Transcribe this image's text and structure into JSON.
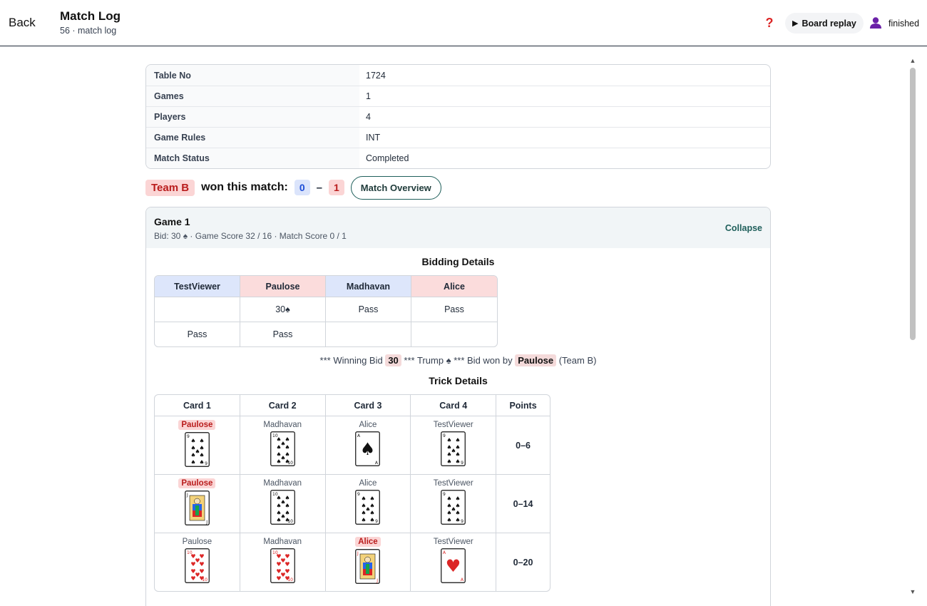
{
  "header": {
    "back_label": "Back",
    "title": "Match Log",
    "subtitle": "56 · match log",
    "help_icon": "question-mark-icon",
    "replay_label": "Board replay",
    "user_status": "finished"
  },
  "info": [
    {
      "key": "Table No",
      "value": "1724"
    },
    {
      "key": "Games",
      "value": "1"
    },
    {
      "key": "Players",
      "value": "4"
    },
    {
      "key": "Game Rules",
      "value": "INT"
    },
    {
      "key": "Match Status",
      "value": "Completed"
    }
  ],
  "result": {
    "team": "Team B",
    "text": "won this match:",
    "score_a": "0",
    "dash": "–",
    "score_b": "1",
    "overview_label": "Match Overview"
  },
  "game": {
    "title": "Game 1",
    "meta": "Bid: 30 ♠   ·   Game Score 32 / 16   ·   Match Score 0 / 1",
    "collapse_label": "Collapse",
    "bidding_title": "Bidding Details",
    "bidding_players": [
      "TestViewer",
      "Paulose",
      "Madhavan",
      "Alice"
    ],
    "bidding_rows": [
      [
        "",
        "30♠",
        "Pass",
        "Pass"
      ],
      [
        "Pass",
        "Pass",
        "",
        ""
      ]
    ],
    "win_prefix": "*** Winning Bid",
    "win_bid": "30",
    "win_trump_text": "***  Trump",
    "win_trump": "♠",
    "win_by_text": "***  Bid won by",
    "win_player": "Paulose",
    "win_team": "(Team B)",
    "trick_title": "Trick Details",
    "trick_headers": [
      "Card 1",
      "Card 2",
      "Card 3",
      "Card 4",
      "Points"
    ],
    "tricks": [
      {
        "players": [
          "Paulose",
          "Madhavan",
          "Alice",
          "TestViewer"
        ],
        "lead": 0,
        "cards": [
          {
            "rank": "9",
            "suit": "♠"
          },
          {
            "rank": "10",
            "suit": "♠"
          },
          {
            "rank": "A",
            "suit": "♠"
          },
          {
            "rank": "9",
            "suit": "♠"
          }
        ],
        "points": "0–6"
      },
      {
        "players": [
          "Paulose",
          "Madhavan",
          "Alice",
          "TestViewer"
        ],
        "lead": 0,
        "cards": [
          {
            "rank": "J",
            "suit": "♠"
          },
          {
            "rank": "10",
            "suit": "♠"
          },
          {
            "rank": "9",
            "suit": "♠"
          },
          {
            "rank": "9",
            "suit": "♠"
          }
        ],
        "points": "0–14"
      },
      {
        "players": [
          "Paulose",
          "Madhavan",
          "Alice",
          "TestViewer"
        ],
        "lead": 2,
        "cards": [
          {
            "rank": "10",
            "suit": "♥"
          },
          {
            "rank": "10",
            "suit": "♥"
          },
          {
            "rank": "J",
            "suit": "♥"
          },
          {
            "rank": "A",
            "suit": "♥"
          }
        ],
        "points": "0–20"
      }
    ]
  },
  "colors": {
    "team_a": "#dde6fb",
    "team_b": "#fbdcdc",
    "accent": "#1f5f5b",
    "red_suit": "#dc2626"
  }
}
